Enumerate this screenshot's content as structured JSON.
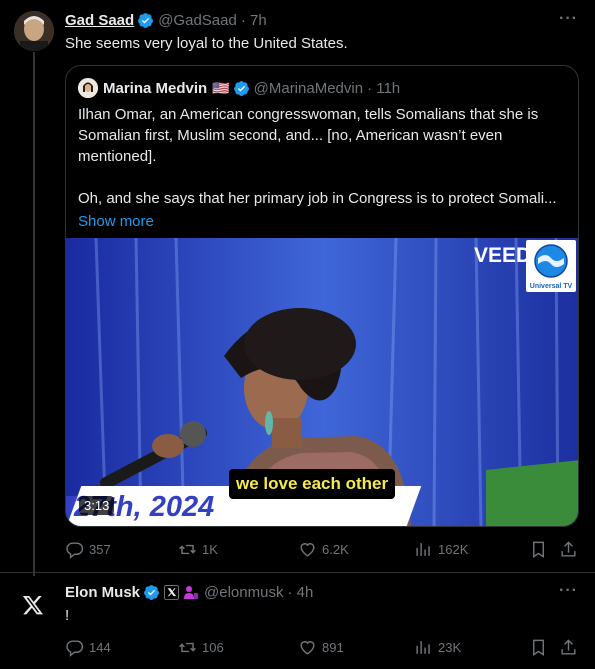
{
  "tweet1": {
    "author_name": "Gad Saad",
    "handle": "@GadSaad",
    "time": "· 7h",
    "text": "She seems very loyal to the United States.",
    "quote": {
      "author_name": "Marina Medvin",
      "flag": "🇺🇸",
      "handle": "@MarinaMedvin",
      "time": "· 11h",
      "lines": [
        "Ilhan Omar, an American congresswoman, tells Somalians that she is",
        "Somalian first, Muslim second, and... [no, American wasn’t even",
        "mentioned].",
        "",
        "Oh, and she says that her primary job in Congress is to protect Somali..."
      ],
      "show_more": "Show more",
      "video": {
        "duration": "3:13",
        "caption": "we love each other",
        "watermark": "VEED",
        "channel_logo": "Universal TV",
        "banner_text": "27th, 2024"
      }
    },
    "stats": {
      "replies": "357",
      "reposts": "1K",
      "likes": "6.2K",
      "views": "162K"
    }
  },
  "tweet2": {
    "author_name": "Elon Musk",
    "handle": "@elonmusk",
    "time": "· 4h",
    "text": "!",
    "stats": {
      "replies": "144",
      "reposts": "106",
      "likes": "891",
      "views": "23K"
    }
  },
  "colors": {
    "accent": "#1d9bf0",
    "muted": "#71767b",
    "background": "#000000",
    "caption_text": "#f6e94c"
  },
  "icons": [
    "more-icon",
    "verified-icon",
    "reply-icon",
    "repost-icon",
    "like-icon",
    "views-icon",
    "bookmark-icon",
    "share-icon",
    "x-logo-icon",
    "affiliate-icon"
  ]
}
